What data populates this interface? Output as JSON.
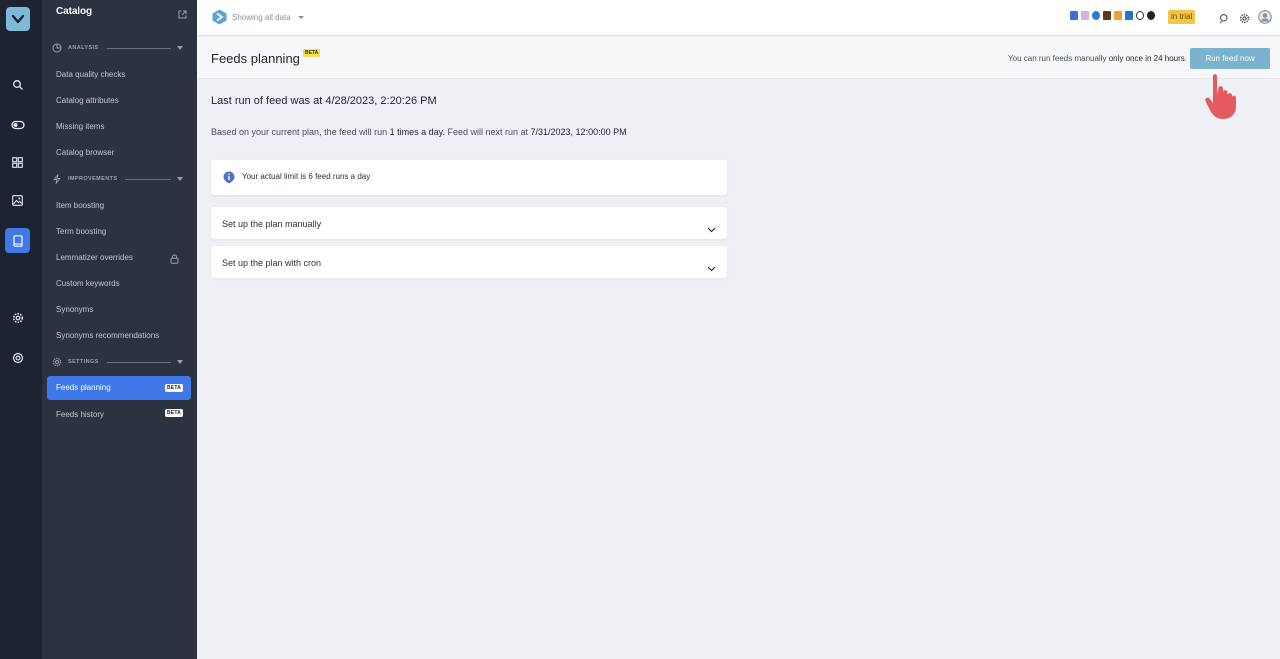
{
  "sidebar": {
    "title": "Catalog",
    "sections": [
      {
        "label": "ANALYSIS"
      },
      {
        "label": "IMPROVEMENTS"
      },
      {
        "label": "SETTINGS"
      }
    ],
    "items": [
      {
        "label": "Data quality checks"
      },
      {
        "label": "Catalog attributes"
      },
      {
        "label": "Missing items"
      },
      {
        "label": "Catalog browser"
      },
      {
        "label": "Item boosting"
      },
      {
        "label": "Term boosting"
      },
      {
        "label": "Lemmatizer overrides"
      },
      {
        "label": "Custom keywords"
      },
      {
        "label": "Synonyms"
      },
      {
        "label": "Synonyms recommendations"
      },
      {
        "label": "Feeds planning",
        "badge": "BETA"
      },
      {
        "label": "Feeds history",
        "badge": "BETA"
      }
    ]
  },
  "topbar": {
    "filter": "Showing all data",
    "trial": "in trial"
  },
  "header": {
    "title": "Feeds planning",
    "badge": "BETA",
    "note_pre": "You can run feeds manually ",
    "note_bold": "only once in 24 hours",
    "note_post": ".",
    "run_button": "Run feed now"
  },
  "content": {
    "last_run": "Last run of feed was at 4/28/2023, 2:20:26 PM",
    "plan_pre": "Based on your current plan, the feed will run ",
    "plan_times": "1 times a day",
    "plan_mid": ". Feed will next run at ",
    "plan_next": "7/31/2023, 12:00:00 PM",
    "info": "Your actual limit is 6 feed runs a day",
    "accordion": [
      {
        "label": "Set up the plan manually"
      },
      {
        "label": "Set up the plan with cron"
      }
    ]
  },
  "colors": {
    "accent": "#3f78e8",
    "run_button": "#79b3cf",
    "trial_badge": "#f1c644",
    "hand": "#e45a5f"
  }
}
